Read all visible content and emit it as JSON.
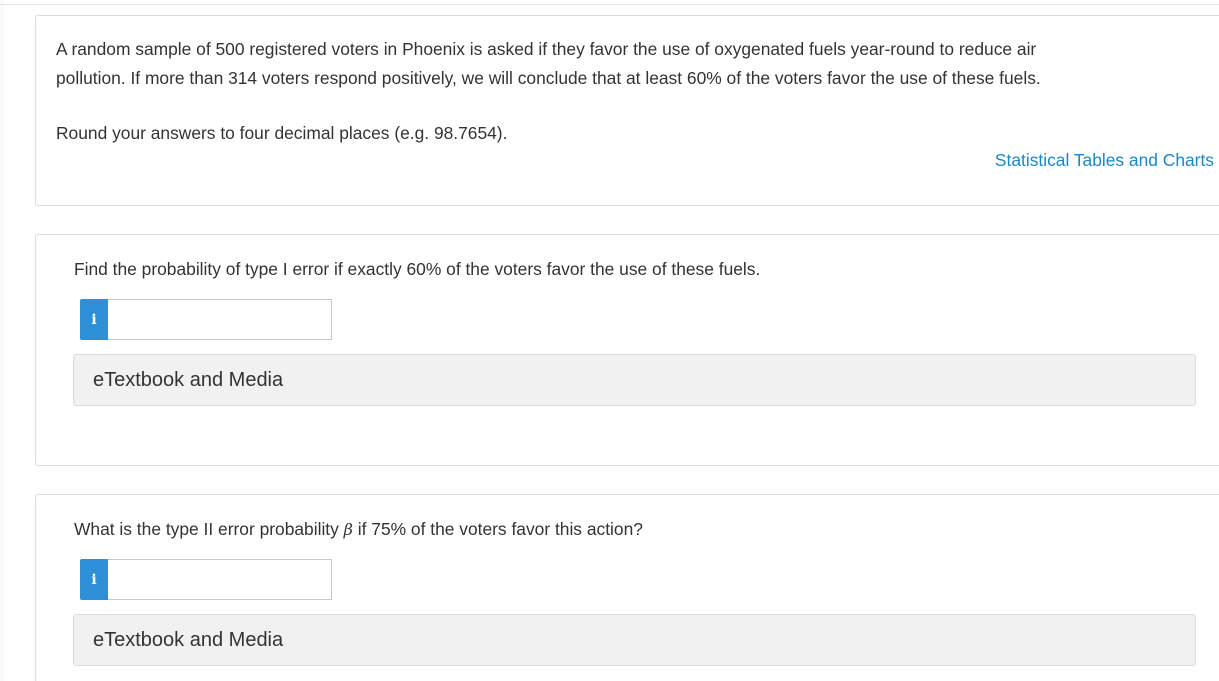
{
  "intro": {
    "line1": "A random sample of 500 registered voters in Phoenix is asked if they favor the use of oxygenated fuels year-round to reduce air",
    "line2": "pollution. If more than 314 voters respond positively, we will conclude that at least 60% of the voters favor the use of these fuels.",
    "round_note": "Round your answers to four decimal places (e.g. 98.7654).",
    "link": "Statistical Tables and Charts"
  },
  "questions": [
    {
      "prompt": "Find the probability of type I error if exactly 60% of the voters favor the use of these fuels.",
      "info_icon": "i",
      "answer_value": "",
      "etextbook_label": "eTextbook and Media"
    },
    {
      "prompt_before": "What is the type II error probability ",
      "prompt_symbol": "β",
      "prompt_after": " if 75% of the voters favor this action?",
      "info_icon": "i",
      "answer_value": "",
      "etextbook_label": "eTextbook and Media"
    }
  ],
  "colors": {
    "link": "#1a87c9",
    "info_icon_bg": "#2d8fd5",
    "etextbook_bg": "#f1f1f1"
  }
}
